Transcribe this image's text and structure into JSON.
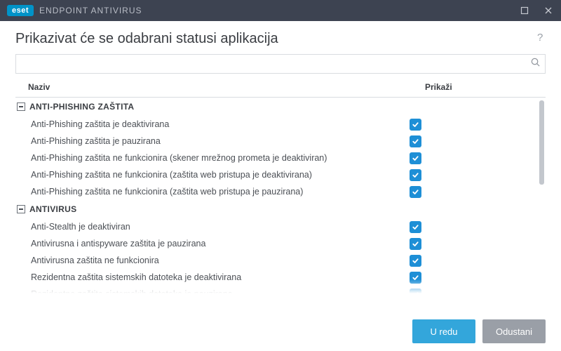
{
  "brand": {
    "badge": "eset",
    "product": "ENDPOINT ANTIVIRUS"
  },
  "header": {
    "title": "Prikazivat će se odabrani statusi aplikacija"
  },
  "search": {
    "value": "",
    "placeholder": ""
  },
  "columns": {
    "name": "Naziv",
    "show": "Prikaži"
  },
  "groups": [
    {
      "label": "ANTI-PHISHING ZAŠTITA",
      "items": [
        {
          "label": "Anti-Phishing zaštita je deaktivirana",
          "checked": true
        },
        {
          "label": "Anti-Phishing zaštita je pauzirana",
          "checked": true
        },
        {
          "label": "Anti-Phishing zaštita ne funkcionira (skener mrežnog prometa je deaktiviran)",
          "checked": true
        },
        {
          "label": "Anti-Phishing zaštita ne funkcionira (zaštita web pristupa je deaktivirana)",
          "checked": true
        },
        {
          "label": "Anti-Phishing zaštita ne funkcionira (zaštita web pristupa je pauzirana)",
          "checked": true
        }
      ]
    },
    {
      "label": "ANTIVIRUS",
      "items": [
        {
          "label": "Anti-Stealth je deaktiviran",
          "checked": true
        },
        {
          "label": "Antivirusna i antispyware zaštita je pauzirana",
          "checked": true
        },
        {
          "label": "Antivirusna zaštita ne funkcionira",
          "checked": true
        },
        {
          "label": "Rezidentna zaštita sistemskih datoteka je deaktivirana",
          "checked": true
        },
        {
          "label": "Rezidentna zaštita sistemskih datoteka je pauzirana",
          "checked": true
        }
      ]
    }
  ],
  "buttons": {
    "ok": "U redu",
    "cancel": "Odustani"
  },
  "colors": {
    "accent": "#1e8fd6",
    "titlebar": "#3d4351",
    "primaryBtn": "#33a6db",
    "secondaryBtn": "#9a9fa7"
  }
}
